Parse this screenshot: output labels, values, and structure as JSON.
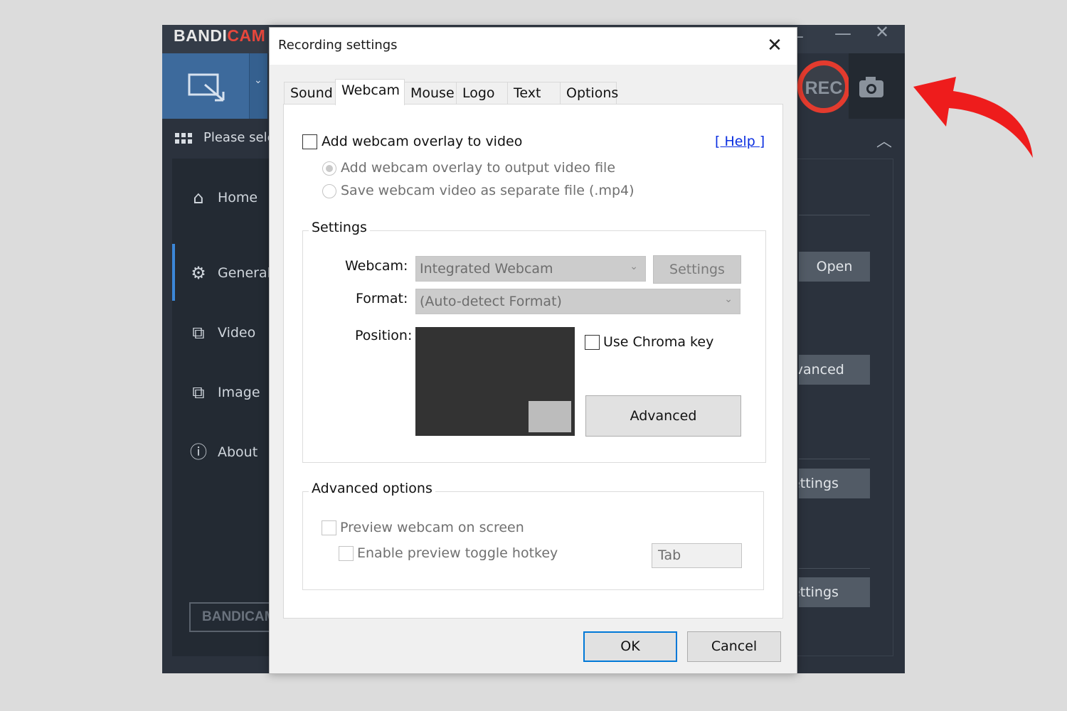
{
  "bandicam": {
    "logo_text": "BANDI",
    "logo_accent": "CAM",
    "select_text": "Please select a mode",
    "rec_label": "REC",
    "sidebar": [
      {
        "label": "Home",
        "icon": "home-icon"
      },
      {
        "label": "General",
        "icon": "gear-icon"
      },
      {
        "label": "Video",
        "icon": "video-settings-icon"
      },
      {
        "label": "Image",
        "icon": "image-settings-icon"
      },
      {
        "label": "About",
        "icon": "info-icon"
      }
    ],
    "side_logo": "BANDICAM",
    "main_buttons": [
      "Open",
      "Advanced",
      "Settings",
      "Settings"
    ]
  },
  "dialog": {
    "title": "Recording settings",
    "close_glyph": "✕",
    "tabs": [
      "Sound",
      "Webcam",
      "Mouse",
      "Logo",
      "Text",
      "Options"
    ],
    "active_tab": "Webcam",
    "add_overlay_label": "Add webcam overlay to video",
    "help_link": "[ Help ]",
    "radio_output": "Add webcam overlay to output video file",
    "radio_separate": "Save webcam video as separate file (.mp4)",
    "settings_group": "Settings",
    "webcam_label": "Webcam:",
    "webcam_value": "Integrated Webcam",
    "webcam_settings_btn": "Settings",
    "format_label": "Format:",
    "format_value": "(Auto-detect Format)",
    "position_label": "Position:",
    "chroma_label": "Use Chroma key",
    "advanced_btn": "Advanced",
    "adv_group": "Advanced options",
    "preview_label": "Preview webcam on screen",
    "toggle_label": "Enable preview toggle hotkey",
    "hotkey_value": "Tab",
    "ok_btn": "OK",
    "cancel_btn": "Cancel"
  },
  "colors": {
    "accent_blue": "#0078d7",
    "rec_red": "#e33b2e",
    "arrow_red": "#ee1c1c"
  }
}
